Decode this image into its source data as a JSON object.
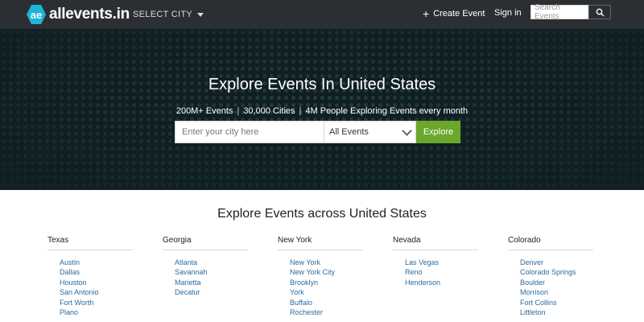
{
  "header": {
    "logo_mark": "ae",
    "logo_text": "allevents.in",
    "select_city": "SELECT CITY",
    "create_event": "Create Event",
    "sign_in": "Sign in",
    "search_placeholder": "Search Events"
  },
  "hero": {
    "title": "Explore Events In United States",
    "stats": [
      "200M+ Events",
      "30,000 Cities",
      "4M People Exploring Events every month"
    ],
    "city_placeholder": "Enter your city here",
    "event_filter": "All Events",
    "explore_label": "Explore"
  },
  "section": {
    "title": "Explore Events across United States"
  },
  "states": [
    {
      "name": "Texas",
      "cities": [
        "Austin",
        "Dallas",
        "Houston",
        "San Antonio",
        "Fort Worth",
        "Plano"
      ]
    },
    {
      "name": "Georgia",
      "cities": [
        "Atlanta",
        "Savannah",
        "Marietta",
        "Decatur"
      ]
    },
    {
      "name": "New York",
      "cities": [
        "New York",
        "New York City",
        "Brooklyn",
        "York",
        "Buffalo",
        "Rochester"
      ]
    },
    {
      "name": "Nevada",
      "cities": [
        "Las Vegas",
        "Reno",
        "Henderson"
      ]
    },
    {
      "name": "Colorado",
      "cities": [
        "Denver",
        "Colorado Springs",
        "Boulder",
        "Morrison",
        "Fort Collins",
        "Littleton"
      ]
    }
  ],
  "colors": {
    "topbar": "#2b2f33",
    "accent": "#00a9c6",
    "explore_button": "#6aa72b",
    "link": "#2c6aa0"
  }
}
